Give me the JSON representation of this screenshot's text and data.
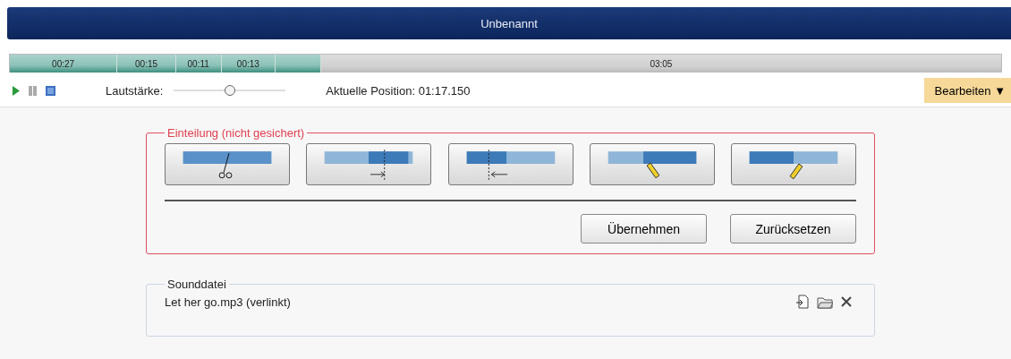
{
  "window": {
    "title": "Unbenannt"
  },
  "timeline": {
    "segments": [
      {
        "label": "00:27",
        "kind": "part"
      },
      {
        "label": "00:15",
        "kind": "part"
      },
      {
        "label": "00:11",
        "kind": "part"
      },
      {
        "label": "00:13",
        "kind": "part"
      },
      {
        "kind": "part"
      },
      {
        "label": "03:05",
        "kind": "rest"
      }
    ]
  },
  "toolbar": {
    "volume_label": "Lautstärke:",
    "volume": {
      "level": 0.5
    },
    "position": "Aktuelle Position: 01:17.150",
    "edit_menu": {
      "label": "Bearbeiten",
      "caret": "▼"
    }
  },
  "division": {
    "title": "Einteilung (nicht gesichert)",
    "unsaved": true,
    "tools": [
      {
        "kind": "cut"
      },
      {
        "kind": "move-right"
      },
      {
        "kind": "move-left"
      },
      {
        "kind": "edit-mid"
      },
      {
        "kind": "edit-left"
      }
    ],
    "buttons": [
      "Übernehmen",
      "Zurücksetzen"
    ]
  },
  "sound_file": {
    "title": "Sounddatei",
    "file": "Let her go.mp3 (verlinkt)"
  }
}
